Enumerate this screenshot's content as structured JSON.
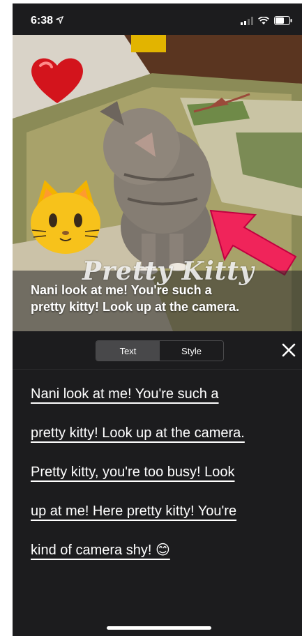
{
  "status_bar": {
    "time": "6:38",
    "location_icon": "location-arrow-icon",
    "icons": [
      "signal-icon",
      "wifi-icon",
      "battery-icon"
    ]
  },
  "photo": {
    "watermark_title": "Pretty Kitty",
    "caption_lines": [
      "Nani look at me!  You're such a",
      "pretty kitty!  Look up at the camera."
    ],
    "stickers": [
      "heart-sticker",
      "cat-face-sticker",
      "red-arrow-sticker"
    ]
  },
  "editor": {
    "tabs": [
      {
        "label": "Text",
        "active": true
      },
      {
        "label": "Style",
        "active": false
      }
    ],
    "close_icon": "close-icon"
  },
  "text_content": {
    "lines": [
      "Nani look at me!  You're such a",
      "pretty kitty!  Look up at the camera.",
      "Pretty kitty,  you're too busy!  Look",
      "up at me!  Here pretty kitty!  You're",
      "kind of camera shy! 😊"
    ]
  },
  "colors": {
    "background": "#1c1c1e",
    "segment_active": "#48484a",
    "arrow": "#f0245a"
  }
}
